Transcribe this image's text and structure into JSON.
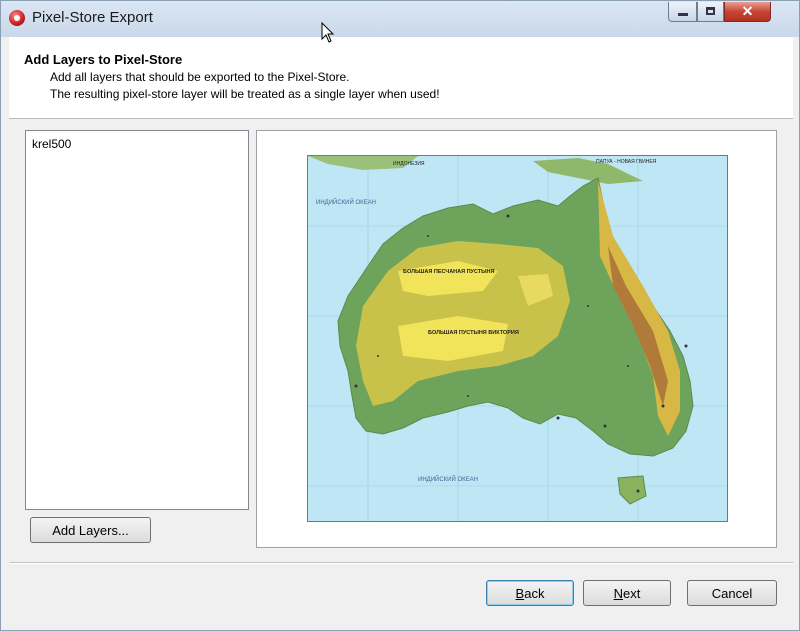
{
  "window": {
    "title": "Pixel-Store Export",
    "close_glyph": "✕"
  },
  "header": {
    "title": "Add Layers to Pixel-Store",
    "line1": "Add all layers that should be exported to the Pixel-Store.",
    "line2": "The resulting pixel-store layer will be treated as a single layer when used!"
  },
  "layers": {
    "items": [
      "krel500"
    ]
  },
  "buttons": {
    "add_layers": "Add Layers...",
    "back_first": "B",
    "back_rest": "ack",
    "next_first": "N",
    "next_rest": "ext",
    "cancel": "Cancel"
  },
  "map": {
    "labels": {
      "ocean_w": "ИНДИЙСКИЙ ОКЕАН",
      "ocean_s": "ИНДИЙСКИЙ ОКЕАН",
      "desert1": "БОЛЬШАЯ ПЕСЧАНАЯ ПУСТЫНЯ",
      "desert2": "БОЛЬШАЯ ПУСТЫНЯ ВИКТОРИЯ",
      "png": "ПАПУА - НОВАЯ ГВИНЕЯ",
      "indonesia": "ИНДОНЕЗИЯ"
    },
    "colors": {
      "sea": "#bfe6f5",
      "lowland": "#6ea35c",
      "plateau": "#c8c24a",
      "desert": "#f1e35a"
    }
  },
  "icons": {
    "app": "pixel-store-app-icon"
  }
}
